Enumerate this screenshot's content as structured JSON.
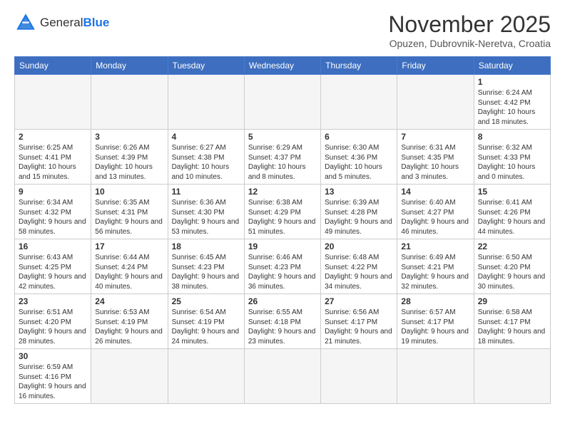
{
  "header": {
    "logo_general": "General",
    "logo_blue": "Blue",
    "month_title": "November 2025",
    "subtitle": "Opuzen, Dubrovnik-Neretva, Croatia"
  },
  "weekdays": [
    "Sunday",
    "Monday",
    "Tuesday",
    "Wednesday",
    "Thursday",
    "Friday",
    "Saturday"
  ],
  "weeks": [
    [
      {
        "day": "",
        "info": ""
      },
      {
        "day": "",
        "info": ""
      },
      {
        "day": "",
        "info": ""
      },
      {
        "day": "",
        "info": ""
      },
      {
        "day": "",
        "info": ""
      },
      {
        "day": "",
        "info": ""
      },
      {
        "day": "1",
        "info": "Sunrise: 6:24 AM\nSunset: 4:42 PM\nDaylight: 10 hours and 18 minutes."
      }
    ],
    [
      {
        "day": "2",
        "info": "Sunrise: 6:25 AM\nSunset: 4:41 PM\nDaylight: 10 hours and 15 minutes."
      },
      {
        "day": "3",
        "info": "Sunrise: 6:26 AM\nSunset: 4:39 PM\nDaylight: 10 hours and 13 minutes."
      },
      {
        "day": "4",
        "info": "Sunrise: 6:27 AM\nSunset: 4:38 PM\nDaylight: 10 hours and 10 minutes."
      },
      {
        "day": "5",
        "info": "Sunrise: 6:29 AM\nSunset: 4:37 PM\nDaylight: 10 hours and 8 minutes."
      },
      {
        "day": "6",
        "info": "Sunrise: 6:30 AM\nSunset: 4:36 PM\nDaylight: 10 hours and 5 minutes."
      },
      {
        "day": "7",
        "info": "Sunrise: 6:31 AM\nSunset: 4:35 PM\nDaylight: 10 hours and 3 minutes."
      },
      {
        "day": "8",
        "info": "Sunrise: 6:32 AM\nSunset: 4:33 PM\nDaylight: 10 hours and 0 minutes."
      }
    ],
    [
      {
        "day": "9",
        "info": "Sunrise: 6:34 AM\nSunset: 4:32 PM\nDaylight: 9 hours and 58 minutes."
      },
      {
        "day": "10",
        "info": "Sunrise: 6:35 AM\nSunset: 4:31 PM\nDaylight: 9 hours and 56 minutes."
      },
      {
        "day": "11",
        "info": "Sunrise: 6:36 AM\nSunset: 4:30 PM\nDaylight: 9 hours and 53 minutes."
      },
      {
        "day": "12",
        "info": "Sunrise: 6:38 AM\nSunset: 4:29 PM\nDaylight: 9 hours and 51 minutes."
      },
      {
        "day": "13",
        "info": "Sunrise: 6:39 AM\nSunset: 4:28 PM\nDaylight: 9 hours and 49 minutes."
      },
      {
        "day": "14",
        "info": "Sunrise: 6:40 AM\nSunset: 4:27 PM\nDaylight: 9 hours and 46 minutes."
      },
      {
        "day": "15",
        "info": "Sunrise: 6:41 AM\nSunset: 4:26 PM\nDaylight: 9 hours and 44 minutes."
      }
    ],
    [
      {
        "day": "16",
        "info": "Sunrise: 6:43 AM\nSunset: 4:25 PM\nDaylight: 9 hours and 42 minutes."
      },
      {
        "day": "17",
        "info": "Sunrise: 6:44 AM\nSunset: 4:24 PM\nDaylight: 9 hours and 40 minutes."
      },
      {
        "day": "18",
        "info": "Sunrise: 6:45 AM\nSunset: 4:23 PM\nDaylight: 9 hours and 38 minutes."
      },
      {
        "day": "19",
        "info": "Sunrise: 6:46 AM\nSunset: 4:23 PM\nDaylight: 9 hours and 36 minutes."
      },
      {
        "day": "20",
        "info": "Sunrise: 6:48 AM\nSunset: 4:22 PM\nDaylight: 9 hours and 34 minutes."
      },
      {
        "day": "21",
        "info": "Sunrise: 6:49 AM\nSunset: 4:21 PM\nDaylight: 9 hours and 32 minutes."
      },
      {
        "day": "22",
        "info": "Sunrise: 6:50 AM\nSunset: 4:20 PM\nDaylight: 9 hours and 30 minutes."
      }
    ],
    [
      {
        "day": "23",
        "info": "Sunrise: 6:51 AM\nSunset: 4:20 PM\nDaylight: 9 hours and 28 minutes."
      },
      {
        "day": "24",
        "info": "Sunrise: 6:53 AM\nSunset: 4:19 PM\nDaylight: 9 hours and 26 minutes."
      },
      {
        "day": "25",
        "info": "Sunrise: 6:54 AM\nSunset: 4:19 PM\nDaylight: 9 hours and 24 minutes."
      },
      {
        "day": "26",
        "info": "Sunrise: 6:55 AM\nSunset: 4:18 PM\nDaylight: 9 hours and 23 minutes."
      },
      {
        "day": "27",
        "info": "Sunrise: 6:56 AM\nSunset: 4:17 PM\nDaylight: 9 hours and 21 minutes."
      },
      {
        "day": "28",
        "info": "Sunrise: 6:57 AM\nSunset: 4:17 PM\nDaylight: 9 hours and 19 minutes."
      },
      {
        "day": "29",
        "info": "Sunrise: 6:58 AM\nSunset: 4:17 PM\nDaylight: 9 hours and 18 minutes."
      }
    ],
    [
      {
        "day": "30",
        "info": "Sunrise: 6:59 AM\nSunset: 4:16 PM\nDaylight: 9 hours and 16 minutes."
      },
      {
        "day": "",
        "info": ""
      },
      {
        "day": "",
        "info": ""
      },
      {
        "day": "",
        "info": ""
      },
      {
        "day": "",
        "info": ""
      },
      {
        "day": "",
        "info": ""
      },
      {
        "day": "",
        "info": ""
      }
    ]
  ]
}
